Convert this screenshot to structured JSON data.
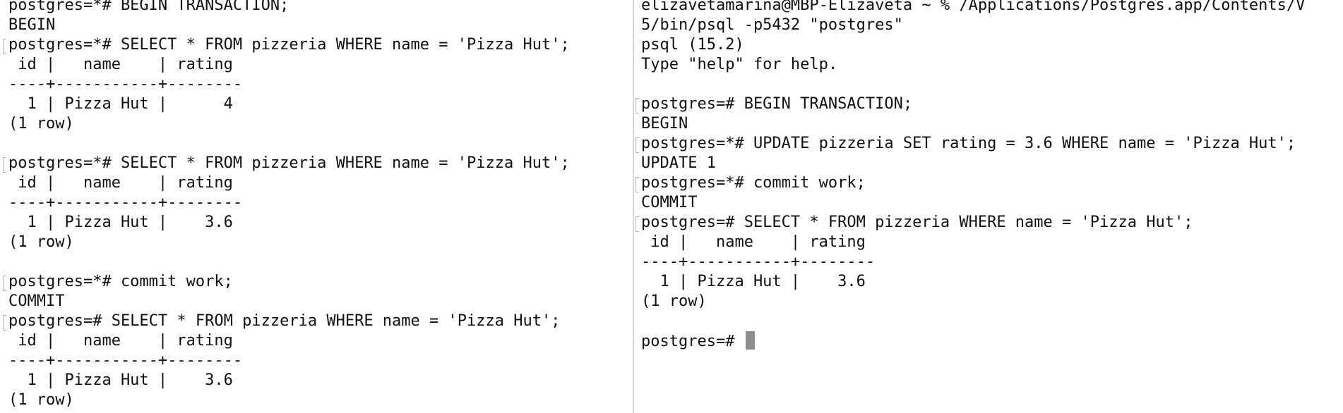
{
  "left_terminal": {
    "lines": [
      "postgres=*# BEGIN TRANSACTION;",
      "BEGIN",
      "postgres=*# SELECT * FROM pizzeria WHERE name = 'Pizza Hut';",
      " id |   name    | rating",
      "----+-----------+--------",
      "  1 | Pizza Hut |      4",
      "(1 row)",
      "",
      "postgres=*# SELECT * FROM pizzeria WHERE name = 'Pizza Hut';",
      " id |   name    | rating",
      "----+-----------+--------",
      "  1 | Pizza Hut |    3.6",
      "(1 row)",
      "",
      "postgres=*# commit work;",
      "COMMIT",
      "postgres=# SELECT * FROM pizzeria WHERE name = 'Pizza Hut';",
      " id |   name    | rating",
      "----+-----------+--------",
      "  1 | Pizza Hut |    3.6",
      "(1 row)"
    ]
  },
  "right_terminal": {
    "lines": [
      "elizavetamarina@MBP-Elizaveta ~ % /Applications/Postgres.app/Contents/V",
      "5/bin/psql -p5432 \"postgres\"",
      "psql (15.2)",
      "Type \"help\" for help.",
      "",
      "postgres=# BEGIN TRANSACTION;",
      "BEGIN",
      "postgres=*# UPDATE pizzeria SET rating = 3.6 WHERE name = 'Pizza Hut';",
      "UPDATE 1",
      "postgres=*# commit work;",
      "COMMIT",
      "postgres=# SELECT * FROM pizzeria WHERE name = 'Pizza Hut';",
      " id |   name    | rating",
      "----+-----------+--------",
      "  1 | Pizza Hut |    3.6",
      "(1 row)",
      ""
    ],
    "prompt": "postgres=# "
  }
}
